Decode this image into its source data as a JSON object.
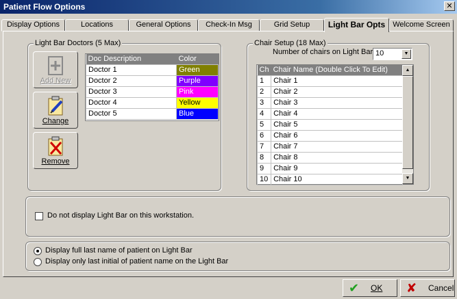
{
  "window": {
    "title": "Patient Flow Options"
  },
  "tabs": [
    {
      "label": "Display Options"
    },
    {
      "label": "Locations"
    },
    {
      "label": "General Options"
    },
    {
      "label": "Check-In Msg"
    },
    {
      "label": "Grid Setup"
    },
    {
      "label": "Light Bar Opts",
      "active": true
    },
    {
      "label": "Welcome Screen"
    }
  ],
  "doctors": {
    "group_title": "Light Bar Doctors (5 Max)",
    "buttons": {
      "add": "Add New",
      "change": "Change",
      "remove": "Remove"
    },
    "columns": [
      "Doc Description",
      "Color"
    ],
    "rows": [
      {
        "name": "Doctor 1",
        "color": "Green",
        "bg": "#808000",
        "fg": "#ffffff"
      },
      {
        "name": "Doctor 2",
        "color": "Purple",
        "bg": "#8000ff",
        "fg": "#ffffff"
      },
      {
        "name": "Doctor 3",
        "color": "Pink",
        "bg": "#ff00ff",
        "fg": "#ffffff"
      },
      {
        "name": "Doctor 4",
        "color": "Yellow",
        "bg": "#ffff00",
        "fg": "#000000"
      },
      {
        "name": "Doctor 5",
        "color": "Blue",
        "bg": "#0000ff",
        "fg": "#ffffff"
      }
    ]
  },
  "chairs": {
    "group_title": "Chair Setup (18 Max)",
    "count_label": "Number of chairs on Light Bar",
    "count_value": "10",
    "columns": [
      "Ch",
      "Chair Name (Double Click To Edit)"
    ],
    "rows": [
      {
        "ch": "1",
        "name": "Chair 1"
      },
      {
        "ch": "2",
        "name": "Chair 2"
      },
      {
        "ch": "3",
        "name": "Chair 3"
      },
      {
        "ch": "4",
        "name": "Chair 4"
      },
      {
        "ch": "5",
        "name": "Chair 5"
      },
      {
        "ch": "6",
        "name": "Chair 6"
      },
      {
        "ch": "7",
        "name": "Chair 7"
      },
      {
        "ch": "8",
        "name": "Chair 8"
      },
      {
        "ch": "9",
        "name": "Chair 9"
      },
      {
        "ch": "10",
        "name": "Chair 10"
      }
    ]
  },
  "workstation": {
    "checkbox_label": "Do not display Light Bar on this workstation."
  },
  "name_display": {
    "option_full": "Display full last name of patient on Light Bar",
    "option_initial": "Display only last initial of patient name on the Light Bar"
  },
  "footer": {
    "ok": "OK",
    "cancel": "Cancel"
  }
}
